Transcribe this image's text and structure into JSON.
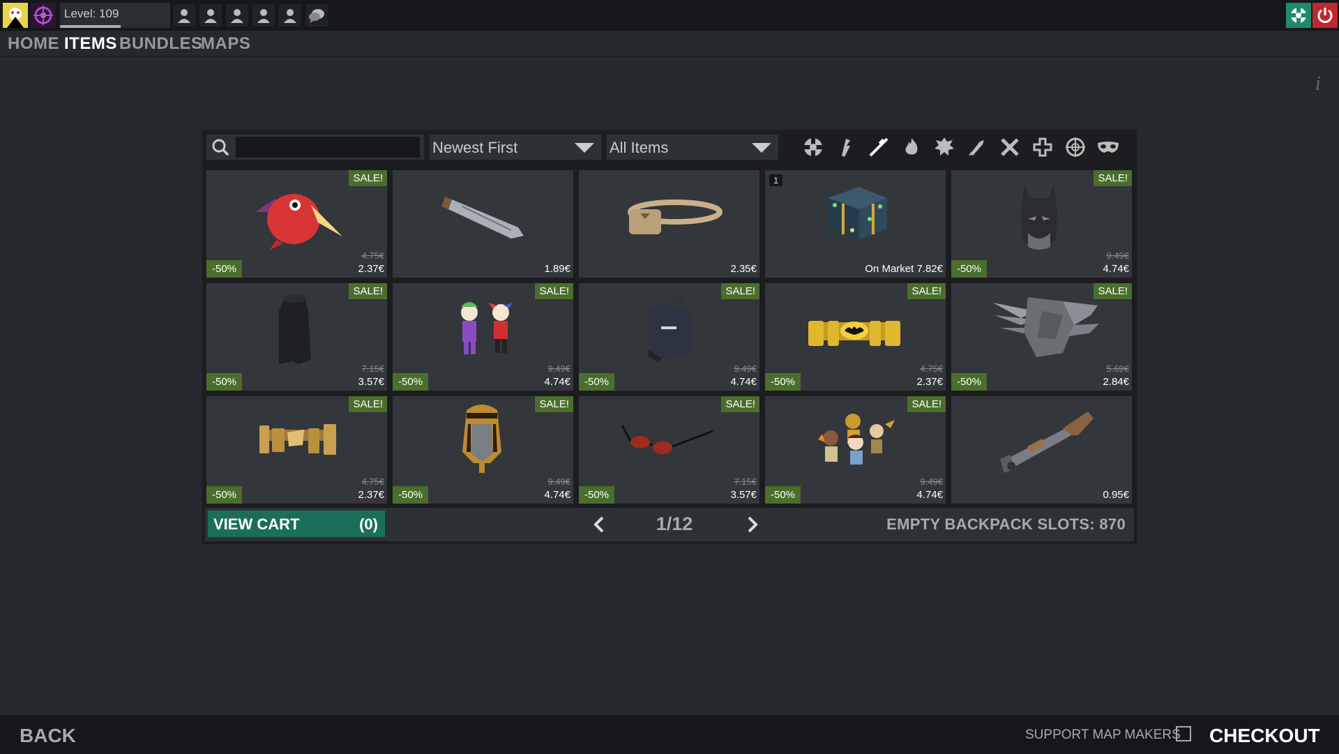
{
  "topbar": {
    "level_text": "Level: 109",
    "level_progress": 0.55
  },
  "nav": {
    "tabs": [
      {
        "label": "HOME",
        "active": false
      },
      {
        "label": "ITEMS",
        "active": true
      },
      {
        "label": "BUNDLES",
        "active": false
      },
      {
        "label": "MAPS",
        "active": false
      }
    ]
  },
  "toolbar": {
    "search_placeholder": "",
    "sort_value": "Newest First",
    "filter_value": "All Items",
    "category_icons": [
      "all-classes-icon",
      "scout-icon",
      "sniper-icon",
      "pyro-icon",
      "heavy-icon",
      "soldier-icon",
      "engineer-icon",
      "medic-icon",
      "crosshair-icon",
      "spy-icon"
    ]
  },
  "items": [
    {
      "sale": "SALE!",
      "discount": "-50%",
      "old_price": "4.75€",
      "price": "2.37€",
      "qty": "",
      "icon": "red-bird-hat-icon"
    },
    {
      "sale": "",
      "discount": "",
      "old_price": "",
      "price": "1.89€",
      "qty": "",
      "icon": "knife-icon"
    },
    {
      "sale": "",
      "discount": "",
      "old_price": "",
      "price": "2.35€",
      "qty": "",
      "icon": "belt-pouch-icon"
    },
    {
      "sale": "",
      "discount": "",
      "old_price": "",
      "price": "On Market 7.82€",
      "qty": "1",
      "icon": "gift-box-icon"
    },
    {
      "sale": "SALE!",
      "discount": "-50%",
      "old_price": "9.49€",
      "price": "4.74€",
      "qty": "",
      "icon": "bat-mask-icon"
    },
    {
      "sale": "SALE!",
      "discount": "-50%",
      "old_price": "7.15€",
      "price": "3.57€",
      "qty": "",
      "icon": "cape-icon"
    },
    {
      "sale": "SALE!",
      "discount": "-50%",
      "old_price": "9.49€",
      "price": "4.74€",
      "qty": "",
      "icon": "joker-dolls-icon"
    },
    {
      "sale": "SALE!",
      "discount": "-50%",
      "old_price": "9.49€",
      "price": "4.74€",
      "qty": "",
      "icon": "dark-helmet-icon"
    },
    {
      "sale": "SALE!",
      "discount": "-50%",
      "old_price": "4.75€",
      "price": "2.37€",
      "qty": "",
      "icon": "utility-belt-icon"
    },
    {
      "sale": "SALE!",
      "discount": "-50%",
      "old_price": "5.69€",
      "price": "2.84€",
      "qty": "",
      "icon": "armored-gauntlet-icon"
    },
    {
      "sale": "SALE!",
      "discount": "-50%",
      "old_price": "4.75€",
      "price": "2.37€",
      "qty": "",
      "icon": "gold-belt-icon"
    },
    {
      "sale": "SALE!",
      "discount": "-50%",
      "old_price": "9.49€",
      "price": "4.74€",
      "qty": "",
      "icon": "pharaoh-head-icon"
    },
    {
      "sale": "SALE!",
      "discount": "-50%",
      "old_price": "7.15€",
      "price": "3.57€",
      "qty": "",
      "icon": "sunglasses-icon"
    },
    {
      "sale": "SALE!",
      "discount": "-50%",
      "old_price": "9.49€",
      "price": "4.74€",
      "qty": "",
      "icon": "adventurer-dolls-icon"
    },
    {
      "sale": "",
      "discount": "",
      "old_price": "",
      "price": "0.95€",
      "qty": "",
      "icon": "shotgun-icon"
    }
  ],
  "pager": {
    "view_cart_label": "VIEW CART",
    "cart_count": "(0)",
    "page_text": "1/12",
    "backpack_slots": "EMPTY BACKPACK SLOTS: 870"
  },
  "footer": {
    "back_label": "BACK",
    "support_label": "SUPPORT MAP MAKERS",
    "support_checked": false,
    "checkout_label": "CHECKOUT"
  },
  "colors": {
    "sale_green": "#4a6e2c",
    "cart_teal": "#1b6e5a",
    "close_red": "#c0282e",
    "accent_teal": "#1e8a6e"
  }
}
